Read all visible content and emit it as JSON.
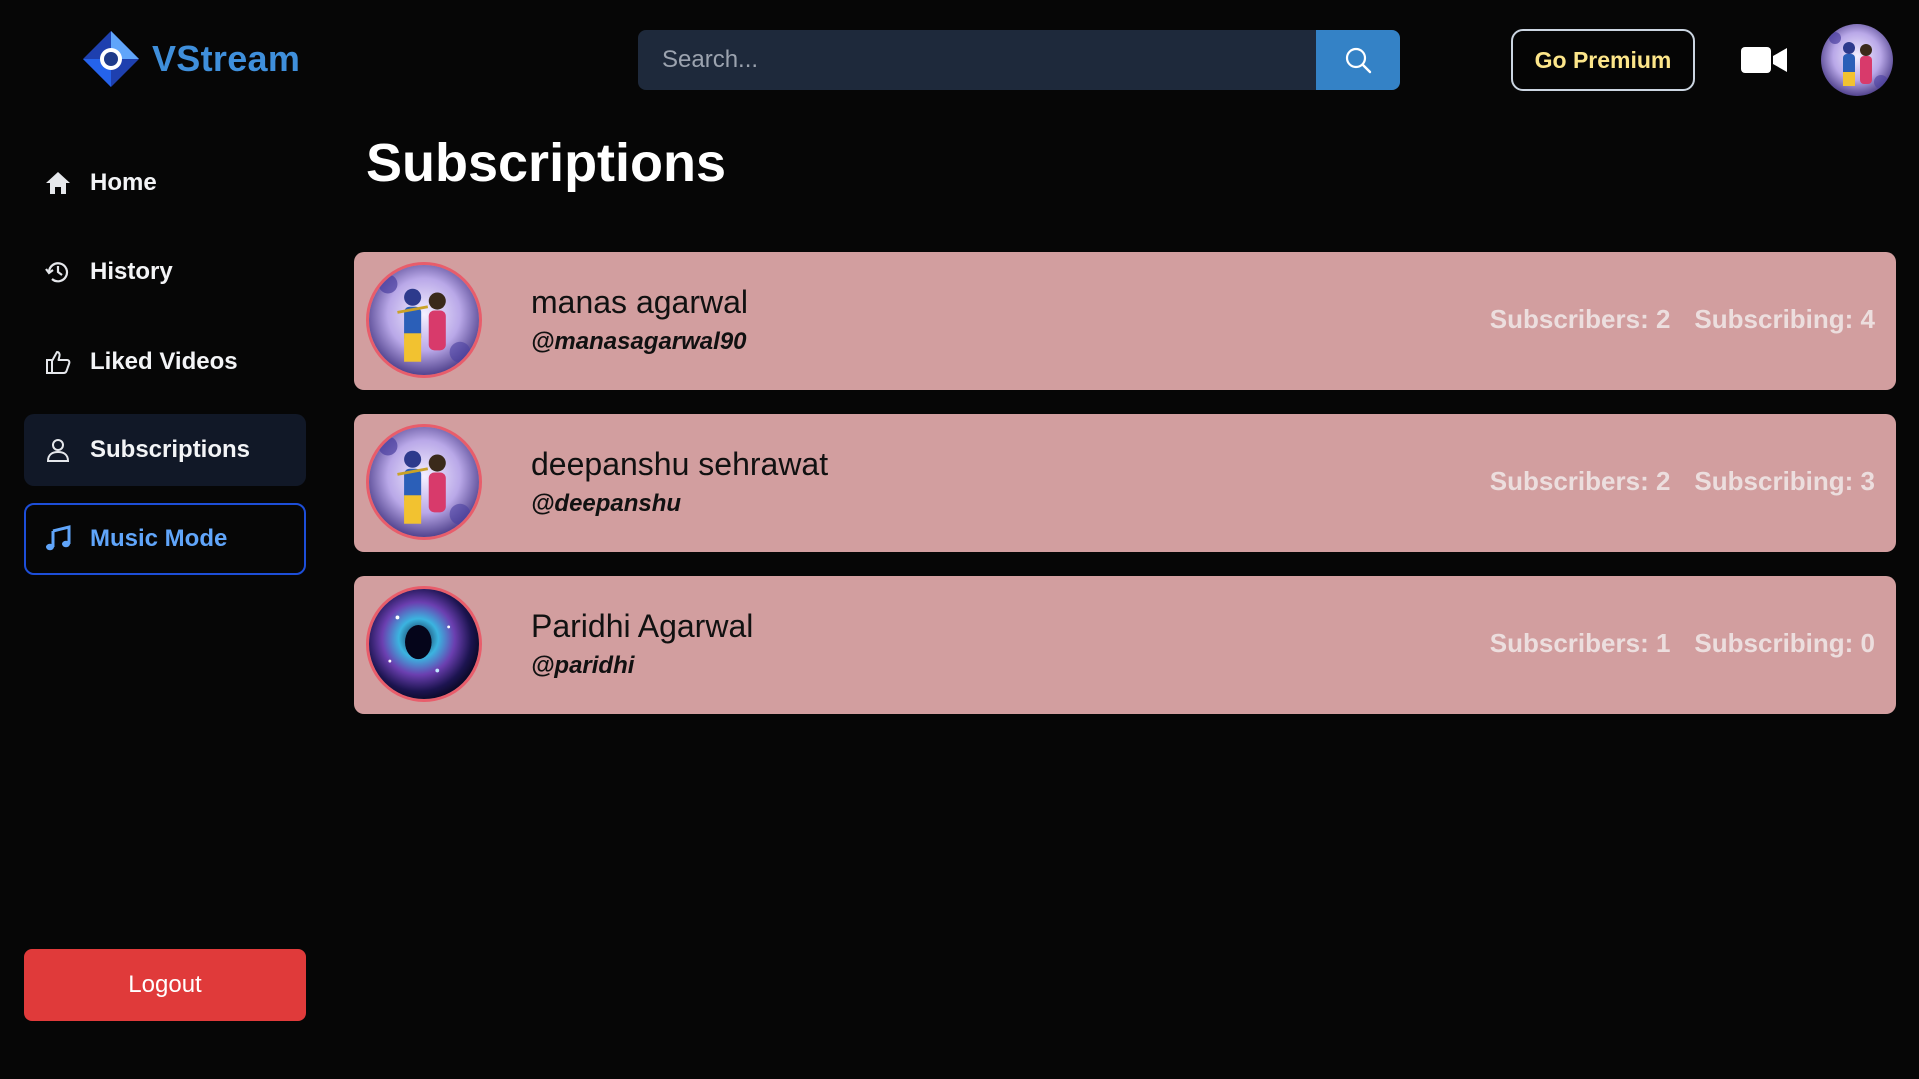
{
  "app": {
    "name": "VStream",
    "brand_color": "#3f8fdb"
  },
  "header": {
    "search_placeholder": "Search...",
    "premium_label": "Go Premium",
    "premium_color": "#fde68a"
  },
  "sidebar": {
    "items": [
      {
        "label": "Home",
        "icon": "home-icon"
      },
      {
        "label": "History",
        "icon": "history-icon"
      },
      {
        "label": "Liked Videos",
        "icon": "thumbs-up-icon"
      },
      {
        "label": "Subscriptions",
        "icon": "user-icon",
        "active": true
      },
      {
        "label": "Music Mode",
        "icon": "music-note-icon",
        "accent": "#60a5fa"
      }
    ],
    "logout_label": "Logout",
    "logout_color": "#e03a3a"
  },
  "main": {
    "title": "Subscriptions",
    "subscriptions": [
      {
        "name": "manas agarwal",
        "handle": "@manasagarwal90",
        "subscribers": "Subscribers: 2",
        "subscribing": "Subscribing: 4",
        "avatar": "krishna-radha-avatar"
      },
      {
        "name": "deepanshu sehrawat",
        "handle": "@deepanshu",
        "subscribers": "Subscribers: 2",
        "subscribing": "Subscribing: 3",
        "avatar": "krishna-radha-avatar"
      },
      {
        "name": "Paridhi Agarwal",
        "handle": "@paridhi",
        "subscribers": "Subscribers: 1",
        "subscribing": "Subscribing: 0",
        "avatar": "nebula-avatar"
      }
    ],
    "card_color": "#d29e9f"
  }
}
